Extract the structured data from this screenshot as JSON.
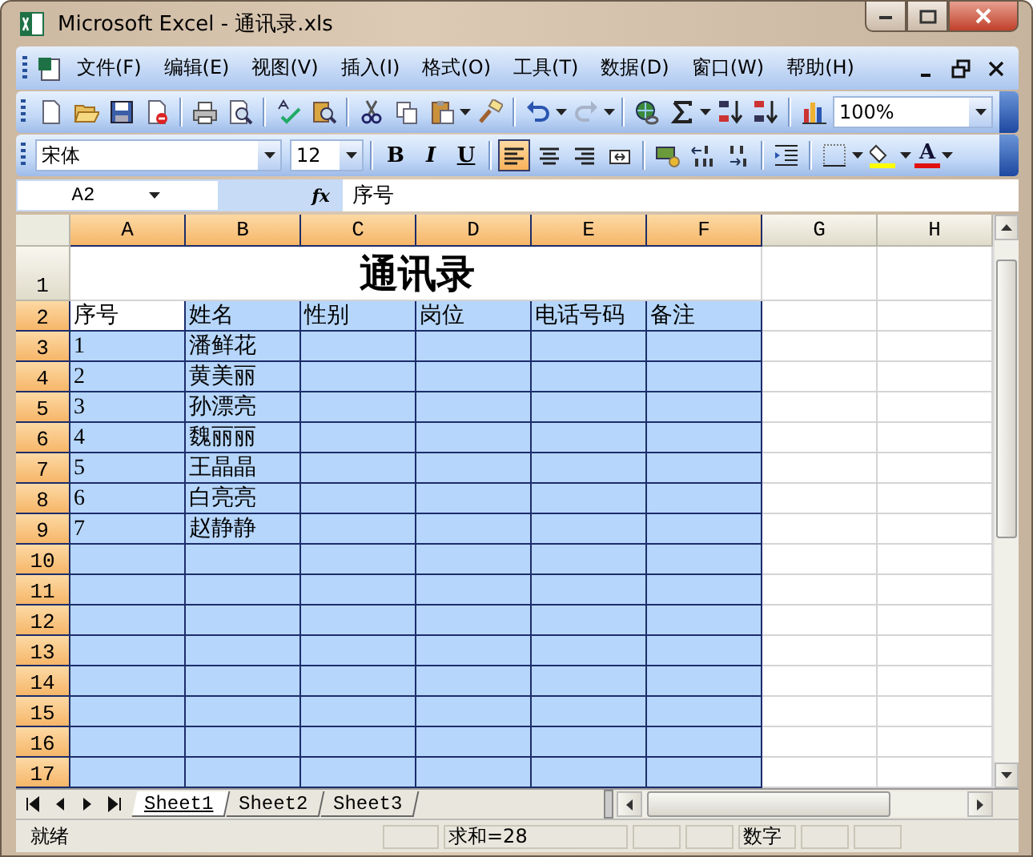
{
  "window": {
    "title": "Microsoft Excel - 通讯录.xls"
  },
  "menu": [
    "文件(F)",
    "编辑(E)",
    "视图(V)",
    "插入(I)",
    "格式(O)",
    "工具(T)",
    "数据(D)",
    "窗口(W)",
    "帮助(H)"
  ],
  "standard_toolbar": {
    "undo": {
      "disabled": false
    },
    "redo": {
      "disabled": true
    },
    "zoom": "100%"
  },
  "formatting_toolbar": {
    "font": "宋体",
    "size": "12",
    "buttons": [
      {
        "kind": "bold",
        "label": "B",
        "selected": false
      },
      {
        "kind": "italic",
        "label": "I",
        "selected": false
      },
      {
        "kind": "underline",
        "label": "U",
        "selected": false
      },
      {
        "kind": "align_left",
        "selected": true
      },
      {
        "kind": "align_center",
        "selected": false
      },
      {
        "kind": "align_right",
        "selected": false
      },
      {
        "kind": "merge",
        "selected": false
      }
    ],
    "font_color_label": "A"
  },
  "formula_bar": {
    "name_box": "A2",
    "fx": "fx",
    "formula": "序号"
  },
  "sheet": {
    "columns": [
      {
        "label": "A",
        "selected": true
      },
      {
        "label": "B",
        "selected": true
      },
      {
        "label": "C",
        "selected": true
      },
      {
        "label": "D",
        "selected": true
      },
      {
        "label": "E",
        "selected": true
      },
      {
        "label": "F",
        "selected": true
      },
      {
        "label": "G",
        "selected": false
      },
      {
        "label": "H",
        "selected": false
      }
    ],
    "rows": [
      {
        "header": "1",
        "selected": false,
        "title": "通讯录"
      },
      {
        "header": "2",
        "selected": true,
        "cells": [
          {
            "text": "序号",
            "active": true
          },
          {
            "text": "姓名",
            "active": false
          },
          {
            "text": "性别",
            "active": false
          },
          {
            "text": "岗位",
            "active": false
          },
          {
            "text": "电话号码",
            "active": false
          },
          {
            "text": "备注",
            "active": false
          }
        ]
      },
      {
        "header": "3",
        "selected": true,
        "cells": [
          {
            "text": "1",
            "active": false
          },
          {
            "text": "潘鲜花",
            "active": false
          }
        ]
      },
      {
        "header": "4",
        "selected": true,
        "cells": [
          {
            "text": "2",
            "active": false
          },
          {
            "text": "黄美丽",
            "active": false
          }
        ]
      },
      {
        "header": "5",
        "selected": true,
        "cells": [
          {
            "text": "3",
            "active": false
          },
          {
            "text": "孙漂亮",
            "active": false
          }
        ]
      },
      {
        "header": "6",
        "selected": true,
        "cells": [
          {
            "text": "4",
            "active": false
          },
          {
            "text": "魏丽丽",
            "active": false
          }
        ]
      },
      {
        "header": "7",
        "selected": true,
        "cells": [
          {
            "text": "5",
            "active": false
          },
          {
            "text": "王晶晶",
            "active": false
          }
        ]
      },
      {
        "header": "8",
        "selected": true,
        "cells": [
          {
            "text": "6",
            "active": false
          },
          {
            "text": "白亮亮",
            "active": false
          }
        ]
      },
      {
        "header": "9",
        "selected": true,
        "cells": [
          {
            "text": "7",
            "active": false
          },
          {
            "text": "赵静静",
            "active": false
          }
        ]
      },
      {
        "header": "10",
        "selected": true
      },
      {
        "header": "11",
        "selected": true
      },
      {
        "header": "12",
        "selected": true
      },
      {
        "header": "13",
        "selected": true
      },
      {
        "header": "14",
        "selected": true
      },
      {
        "header": "15",
        "selected": true
      },
      {
        "header": "16",
        "selected": true
      },
      {
        "header": "17",
        "selected": true
      }
    ]
  },
  "sheet_tabs": [
    {
      "label": "Sheet1",
      "selected": true
    },
    {
      "label": "Sheet2",
      "selected": false
    },
    {
      "label": "Sheet3",
      "selected": false
    }
  ],
  "status_bar": {
    "status": "就绪",
    "sum": "求和=28",
    "mode": "数字"
  }
}
